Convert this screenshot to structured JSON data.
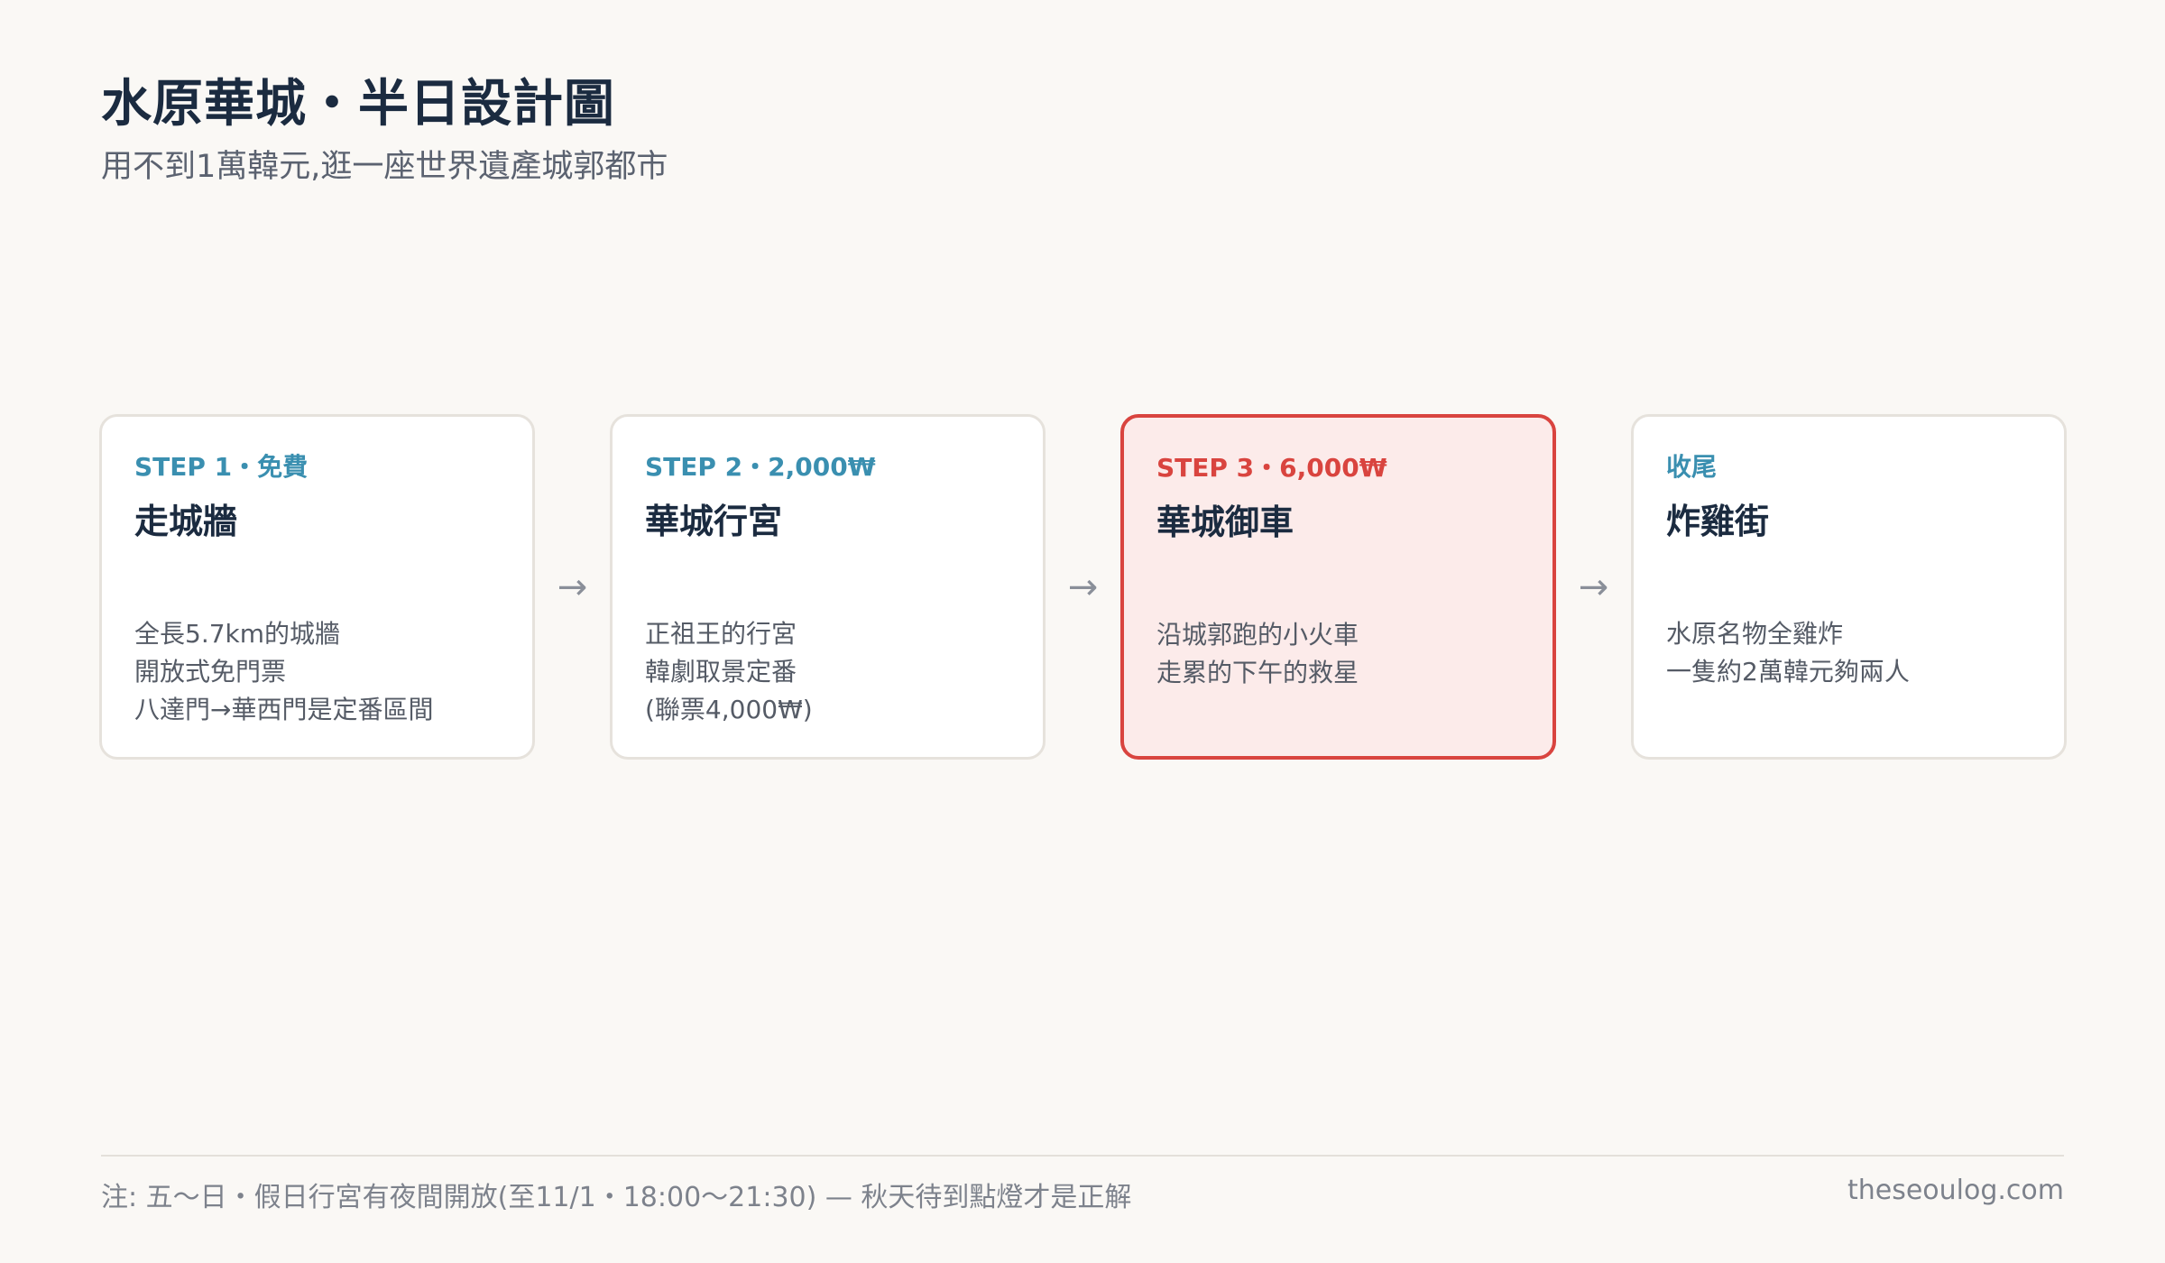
{
  "header": {
    "title": "水原華城・半日設計圖",
    "subtitle": "用不到1萬韓元,逛一座世界遺產城郭都市"
  },
  "steps": [
    {
      "step_label": "STEP 1・免費",
      "name": "走城牆",
      "lines": [
        "全長5.7km的城牆",
        "開放式免門票",
        "八達門→華西門是定番區間"
      ]
    },
    {
      "step_label": "STEP 2・2,000₩",
      "name": "華城行宮",
      "lines": [
        "正祖王的行宮",
        "韓劇取景定番",
        "(聯票4,000₩)"
      ]
    },
    {
      "step_label": "STEP 3・6,000₩",
      "name": "華城御車",
      "lines": [
        "沿城郭跑的小火車",
        "走累的下午的救星"
      ]
    },
    {
      "step_label": "收尾",
      "name": "炸雞街",
      "lines": [
        "水原名物全雞炸",
        "一隻約2萬韓元夠兩人"
      ]
    }
  ],
  "arrow_symbol": "→",
  "footer": {
    "note": "注: 五〜日・假日行宮有夜間開放(至11/1・18:00〜21:30) — 秋天待到點燈才是正解",
    "site": "theseoulog.com"
  },
  "colors": {
    "accent_blue": "#3a8fb0",
    "accent_red": "#d9443f",
    "highlight_bg": "#fcebea",
    "title": "#1b2b40"
  }
}
